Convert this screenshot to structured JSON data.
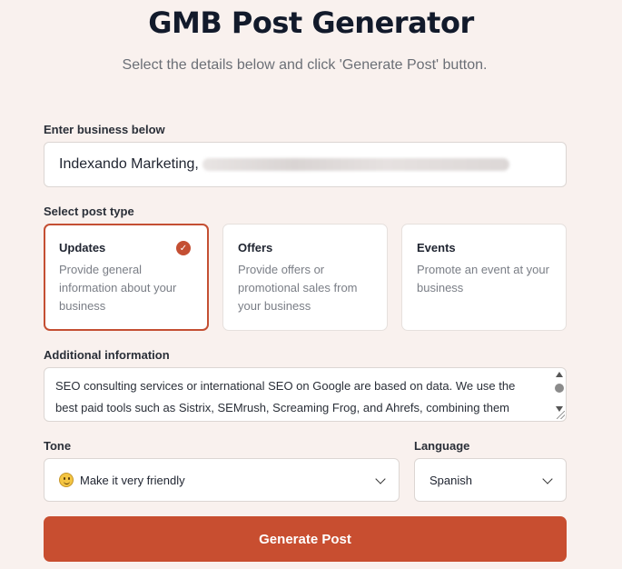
{
  "header": {
    "title": "GMB Post Generator",
    "subtitle": "Select the details below and click 'Generate Post' button."
  },
  "business": {
    "label": "Enter business below",
    "value": "Indexando Marketing,"
  },
  "post_type": {
    "label": "Select post type",
    "options": [
      {
        "title": "Updates",
        "description": "Provide general information about your business",
        "selected": true
      },
      {
        "title": "Offers",
        "description": "Provide offers or promotional sales from your business",
        "selected": false
      },
      {
        "title": "Events",
        "description": "Promote an event at your business",
        "selected": false
      }
    ]
  },
  "additional": {
    "label": "Additional information",
    "value": "SEO consulting services or international SEO on Google are based on data. We use the best paid tools such as Sistrix, SEMrush, Screaming Frog, and Ahrefs, combining them"
  },
  "tone": {
    "label": "Tone",
    "value": "Make it very friendly",
    "icon": "smiley-emoji-icon"
  },
  "language": {
    "label": "Language",
    "value": "Spanish"
  },
  "actions": {
    "generate_label": "Generate Post"
  },
  "colors": {
    "accent": "#c84e30",
    "background": "#f9f1ee"
  }
}
